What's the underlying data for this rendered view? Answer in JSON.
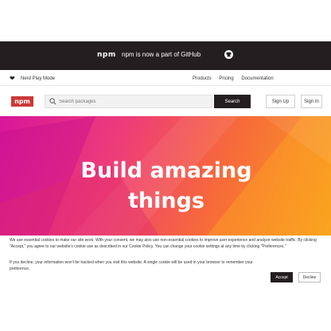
{
  "banner": {
    "logo": "npm",
    "text": "npm is now a part of GitHub",
    "links": [
      "Product",
      "Pricing",
      "Documentation"
    ]
  },
  "nav": {
    "tagline": "Nerd Play Mode",
    "links": [
      "Products",
      "Pricing",
      "Documentation"
    ]
  },
  "search": {
    "logo": "npm",
    "placeholder": "Search packages",
    "button_label": "Search"
  },
  "auth": {
    "signup_label": "Sign Up",
    "signin_label": "Sign In"
  },
  "hero": {
    "title": "Build amazing things"
  },
  "cookie": {
    "text": "We use essential cookies to make our site work. With your consent, we may also use non-essential cookies to improve user experience and analyze website traffic. By clicking \"Accept,\" you agree to our website's cookie use as described in our Cookie Policy. You can change your cookie settings at any time by clicking \"Preferences.\"",
    "text2": "If you decline, your information won't be tracked when you visit this website. A single cookie will be used in your browser to remember your preference.",
    "accept_label": "Accept",
    "decline_label": "Decline"
  },
  "colors": {
    "banner": "#231f20",
    "brand": "#cb3837",
    "hero_start": "#d8169a",
    "hero_end": "#f7a01e"
  },
  "icons": [
    "github-icon",
    "heart-icon",
    "search-icon"
  ]
}
